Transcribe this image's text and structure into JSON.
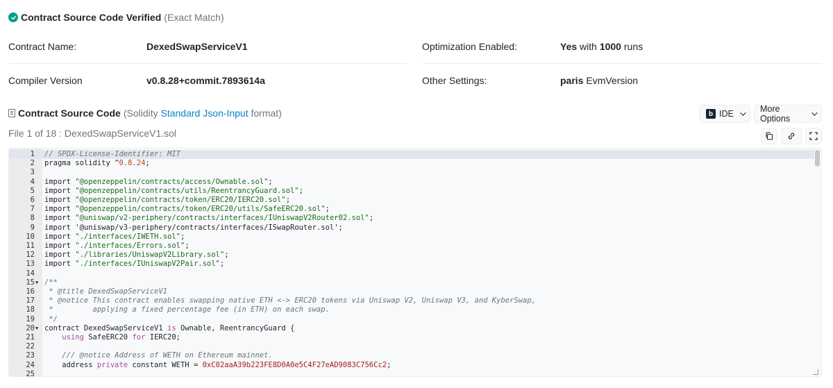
{
  "verified": {
    "title": "Contract Source Code Verified",
    "subtitle": "(Exact Match)",
    "accent": "#00a186"
  },
  "info": {
    "contract_name_label": "Contract Name:",
    "contract_name": "DexedSwapServiceV1",
    "compiler_label": "Compiler Version",
    "compiler": "v0.8.28+commit.7893614a",
    "optimization_label": "Optimization Enabled:",
    "optimization_yes": "Yes",
    "optimization_with": "with",
    "optimization_runs": "1000",
    "optimization_runs_suffix": "runs",
    "settings_label": "Other Settings:",
    "settings_value": "paris",
    "settings_suffix": "EvmVersion"
  },
  "source": {
    "title": "Contract Source Code",
    "sub_prefix": "(Solidity",
    "sub_link": "Standard Json-Input",
    "sub_suffix": "format)",
    "link_color": "#0784c3",
    "ide_label": "IDE",
    "ide_logo": "b",
    "more_options_label": "More Options",
    "file_label": "File 1 of 18 : DexedSwapServiceV1.sol"
  },
  "icons": {
    "copy": "copy-icon",
    "link": "link-icon",
    "fullscreen": "fullscreen-icon"
  },
  "code_lines": [
    {
      "n": "1",
      "html": "<span class=\"cm\">// SPDX-License-Identifier: MIT</span>"
    },
    {
      "n": "2",
      "html": "pragma solidity ^<span class=\"num\">0.8.24</span>;"
    },
    {
      "n": "3",
      "html": ""
    },
    {
      "n": "4",
      "html": "import <span class=\"str\">\"@openzeppelin/contracts/access/Ownable.sol\"</span>;"
    },
    {
      "n": "5",
      "html": "import <span class=\"str\">\"@openzeppelin/contracts/utils/ReentrancyGuard.sol\"</span>;"
    },
    {
      "n": "6",
      "html": "import <span class=\"str\">\"@openzeppelin/contracts/token/ERC20/IERC20.sol\"</span>;"
    },
    {
      "n": "7",
      "html": "import <span class=\"str\">\"@openzeppelin/contracts/token/ERC20/utils/SafeERC20.sol\"</span>;"
    },
    {
      "n": "8",
      "html": "import <span class=\"str\">\"@uniswap/v2-periphery/contracts/interfaces/IUniswapV2Router02.sol\"</span>;"
    },
    {
      "n": "9",
      "html": "import '@uniswap/v3-periphery/contracts/interfaces/ISwapRouter.sol';"
    },
    {
      "n": "10",
      "html": "import <span class=\"str\">\"./interfaces/IWETH.sol\"</span>;"
    },
    {
      "n": "11",
      "html": "import <span class=\"str\">\"./interfaces/Errors.sol\"</span>;"
    },
    {
      "n": "12",
      "html": "import <span class=\"str\">\"./libraries/UniswapV2Library.sol\"</span>;"
    },
    {
      "n": "13",
      "html": "import <span class=\"str\">\"./interfaces/IUniswapV2Pair.sol\"</span>;"
    },
    {
      "n": "14",
      "html": ""
    },
    {
      "n": "15",
      "fold": true,
      "html": "<span class=\"cm\">/**</span>"
    },
    {
      "n": "16",
      "html": "<span class=\"cm\"> * @title DexedSwapServiceV1</span>"
    },
    {
      "n": "17",
      "html": "<span class=\"cm\"> * @notice This contract enables swapping native ETH &lt;-&gt; ERC20 tokens via Uniswap V2, Uniswap V3, and KyberSwap,</span>"
    },
    {
      "n": "18",
      "html": "<span class=\"cm\"> *         applying a fixed percentage fee (in ETH) on each swap.</span>"
    },
    {
      "n": "19",
      "html": "<span class=\"cm\"> */</span>"
    },
    {
      "n": "20",
      "fold": true,
      "html": "contract DexedSwapServiceV1 <span class=\"kw\">is</span> Ownable, ReentrancyGuard {"
    },
    {
      "n": "21",
      "html": "    <span class=\"kw\">using</span> SafeERC20 <span class=\"kw\">for</span> IERC20;"
    },
    {
      "n": "22",
      "html": ""
    },
    {
      "n": "23",
      "html": "    <span class=\"cm\">/// @notice Address of WETH on Ethereum mainnet.</span>"
    },
    {
      "n": "24",
      "html": "    address <span class=\"kw\">private</span> constant WETH = <span class=\"addr\">0xC02aaA39b223FE8D0A0e5C4F27eAD9083C756Cc2</span>;"
    },
    {
      "n": "25",
      "html": ""
    }
  ]
}
